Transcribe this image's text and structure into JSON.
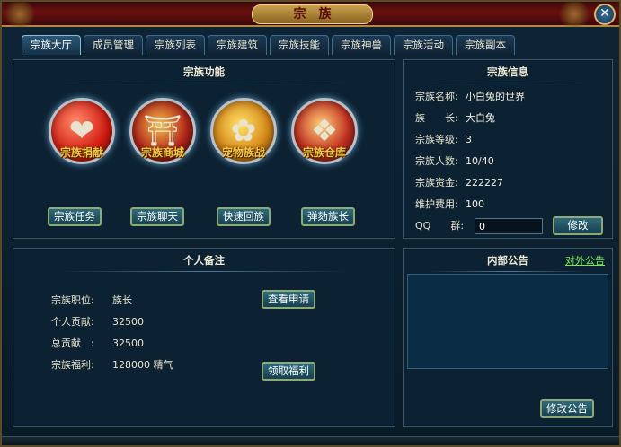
{
  "window": {
    "title": "宗族",
    "close_label": "✕"
  },
  "tabs": [
    {
      "label": "宗族大厅",
      "active": true
    },
    {
      "label": "成员管理"
    },
    {
      "label": "宗族列表"
    },
    {
      "label": "宗族建筑"
    },
    {
      "label": "宗族技能"
    },
    {
      "label": "宗族神兽"
    },
    {
      "label": "宗族活动"
    },
    {
      "label": "宗族副本"
    }
  ],
  "functions": {
    "title": "宗族功能",
    "orbs": [
      {
        "label": "宗族捐献",
        "icon": "heart-icon"
      },
      {
        "label": "宗族商城",
        "icon": "shop-icon"
      },
      {
        "label": "宠物族战",
        "icon": "pet-battle-icon"
      },
      {
        "label": "宗族仓库",
        "icon": "treasure-chest-icon"
      }
    ],
    "buttons": [
      {
        "label": "宗族任务"
      },
      {
        "label": "宗族聊天"
      },
      {
        "label": "快速回族"
      },
      {
        "label": "弹劾族长"
      }
    ]
  },
  "info": {
    "title": "宗族信息",
    "rows": [
      {
        "key": "宗族名称:",
        "value": "小白兔的世界"
      },
      {
        "key": "族　　长:",
        "value": "大白兔"
      },
      {
        "key": "宗族等级:",
        "value": "3"
      },
      {
        "key": "宗族人数:",
        "value": "10/40"
      },
      {
        "key": "宗族资金:",
        "value": "222227"
      },
      {
        "key": "维护费用:",
        "value": "100"
      }
    ],
    "qq_label": "QQ　　群:",
    "qq_value": "0",
    "edit_button": "修改"
  },
  "notes": {
    "title": "个人备注",
    "rows": [
      {
        "key": "宗族职位:",
        "value": "族长"
      },
      {
        "key": "个人贡献:",
        "value": "32500"
      },
      {
        "key": "总贡献　:",
        "value": "32500"
      },
      {
        "key": "宗族福利:",
        "value": "128000  精气"
      }
    ],
    "view_apply_button": "查看申请",
    "claim_button": "领取福利"
  },
  "notice": {
    "title": "内部公告",
    "external_link": "对外公告",
    "edit_button": "修改公告"
  }
}
